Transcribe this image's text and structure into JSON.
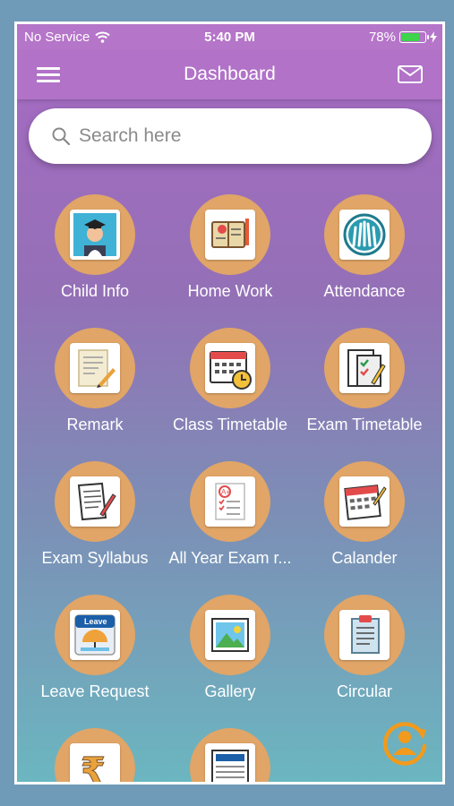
{
  "status_bar": {
    "carrier": "No Service",
    "time": "5:40 PM",
    "battery": "78%",
    "battery_level": 0.78
  },
  "navbar": {
    "title": "Dashboard",
    "menu_icon": "hamburger-menu-icon",
    "mail_icon": "mail-icon"
  },
  "search": {
    "placeholder": "Search here",
    "value": ""
  },
  "tiles": [
    {
      "label": "Child Info",
      "icon": "student-graduate-icon"
    },
    {
      "label": "Home Work",
      "icon": "homework-book-icon"
    },
    {
      "label": "Attendance",
      "icon": "raised-hands-icon"
    },
    {
      "label": "Remark",
      "icon": "note-pencil-icon"
    },
    {
      "label": "Class Timetable",
      "icon": "calendar-clock-icon"
    },
    {
      "label": "Exam Timetable",
      "icon": "exam-checklist-icon"
    },
    {
      "label": "Exam Syllabus",
      "icon": "syllabus-document-icon"
    },
    {
      "label": "All Year Exam r...",
      "icon": "report-card-icon"
    },
    {
      "label": "Calander",
      "icon": "calendar-pages-icon"
    },
    {
      "label": "Leave Request",
      "icon": "leave-umbrella-icon"
    },
    {
      "label": "Gallery",
      "icon": "gallery-image-icon"
    },
    {
      "label": "Circular",
      "icon": "circular-clipboard-icon"
    },
    {
      "label": "",
      "icon": "rupee-fees-icon"
    },
    {
      "label": "",
      "icon": "newspaper-icon"
    }
  ],
  "colors": {
    "accent": "#b172c8",
    "tile_circle": "#e0a567",
    "fab": "#f29a1c"
  },
  "fab_icon": "switch-user-icon"
}
